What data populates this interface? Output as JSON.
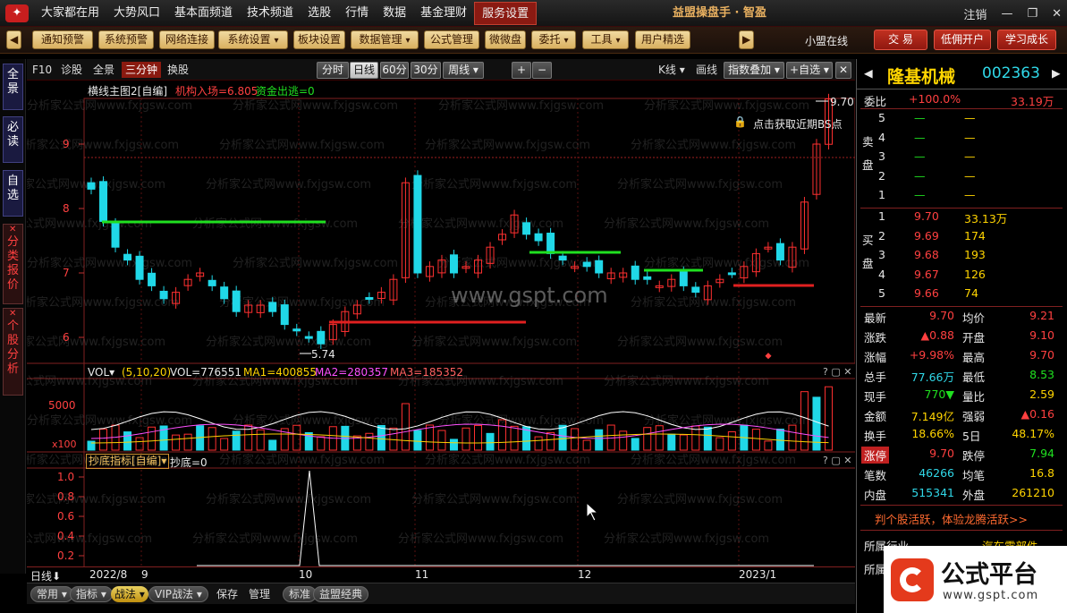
{
  "menu": {
    "items": [
      "大家都在用",
      "大势风口",
      "基本面频道",
      "技术频道",
      "选股",
      "行情",
      "数据",
      "基金理财",
      "服务设置"
    ],
    "brand": "益盟操盘手 · 智盈",
    "logout": "注销"
  },
  "toolbar": {
    "items": [
      "通知预警",
      "系统预警",
      "网络连接",
      "系统设置",
      "板块设置",
      "数据管理",
      "公式管理",
      "微微盘",
      "委托",
      "工具",
      "用户精选"
    ],
    "online": "小盟在线",
    "trade": "交 易",
    "lowfee": "低佣开户",
    "learn": "学习成长"
  },
  "sidetabs": [
    "全景",
    "必读",
    "自选",
    "分类报价",
    "个股分析"
  ],
  "chartbar": {
    "f10": "F10",
    "diag": "诊股",
    "full": "全景",
    "three": "三分钟",
    "swap": "换股",
    "periods": [
      "分时",
      "日线",
      "60分",
      "30分",
      "周线"
    ],
    "kline": "K线",
    "draw": "画线",
    "overlay": "指数叠加",
    "addfav": "+自选"
  },
  "main": {
    "title": "横线主图2[自编]",
    "inst": "机构入场=6.805",
    "fund": "资金出逃=0",
    "lock": "点击获取近期BS点",
    "watermark": "www.gspt.com",
    "wm": "分析家公式网www.fxjgsw.com",
    "price_axis": [
      "9",
      "8",
      "7",
      "6"
    ],
    "high": "9.70",
    "low": "5.74"
  },
  "vol": {
    "name": "VOL",
    "params": "(5,10,20)",
    "vol": "VOL=776551",
    "ma1": "MA1=400855",
    "ma2": "MA2=280357",
    "ma3": "MA3=185352",
    "axis": "5000",
    "unit": "x100"
  },
  "ind": {
    "name": "抄底指标[自编]",
    "value": "抄底=0",
    "axis": [
      "1.0",
      "0.8",
      "0.6",
      "0.4",
      "0.2"
    ]
  },
  "xaxis": {
    "label": "日线",
    "ticks": [
      "2022/8",
      "9",
      "10",
      "11",
      "12",
      "2023/1"
    ]
  },
  "bottom": {
    "items": [
      "常用",
      "指标",
      "战法",
      "VIP战法",
      "保存",
      "管理",
      "标准",
      "益盟经典"
    ]
  },
  "stock": {
    "name": "隆基机械",
    "code": "002363"
  },
  "order": {
    "wb_label": "委比",
    "wb": "+100.0%",
    "wb_vol": "33.19万",
    "sell_label": "卖盘",
    "buy_label": "买盘",
    "sells": [
      {
        "n": "5",
        "p": "—",
        "v": "—"
      },
      {
        "n": "4",
        "p": "—",
        "v": "—"
      },
      {
        "n": "3",
        "p": "—",
        "v": "—"
      },
      {
        "n": "2",
        "p": "—",
        "v": "—"
      },
      {
        "n": "1",
        "p": "—",
        "v": "—"
      }
    ],
    "buys": [
      {
        "n": "1",
        "p": "9.70",
        "v": "33.13万"
      },
      {
        "n": "2",
        "p": "9.69",
        "v": "174"
      },
      {
        "n": "3",
        "p": "9.68",
        "v": "193"
      },
      {
        "n": "4",
        "p": "9.67",
        "v": "126"
      },
      {
        "n": "5",
        "p": "9.66",
        "v": "74"
      }
    ]
  },
  "quote": [
    {
      "l1": "最新",
      "v1": "9.70",
      "l2": "均价",
      "v2": "9.21"
    },
    {
      "l1": "涨跌",
      "v1": "▲0.88",
      "l2": "开盘",
      "v2": "9.10"
    },
    {
      "l1": "涨幅",
      "v1": "+9.98%",
      "l2": "最高",
      "v2": "9.70"
    },
    {
      "l1": "总手",
      "v1": "77.66万",
      "l2": "最低",
      "v2": "8.53"
    },
    {
      "l1": "现手",
      "v1": "770▼",
      "l2": "量比",
      "v2": "2.59"
    },
    {
      "l1": "金额",
      "v1": "7.149亿",
      "l2": "强弱",
      "v2": "▲0.16"
    },
    {
      "l1": "换手",
      "v1": "18.66%",
      "l2": "5日",
      "v2": "48.17%"
    },
    {
      "l1": "涨停",
      "v1": "9.70",
      "l2": "跌停",
      "v2": "7.94"
    },
    {
      "l1": "笔数",
      "v1": "46266",
      "l2": "均笔",
      "v2": "16.8"
    },
    {
      "l1": "内盘",
      "v1": "515341",
      "l2": "外盘",
      "v2": "261210"
    }
  ],
  "promo": "判个股活跃，体验龙腾活跃>>",
  "industry": {
    "label": "所属行业",
    "value": "汽车零部件",
    "label2": "所属"
  },
  "corner": {
    "text": "公式平台",
    "url": "www.gspt.com"
  }
}
